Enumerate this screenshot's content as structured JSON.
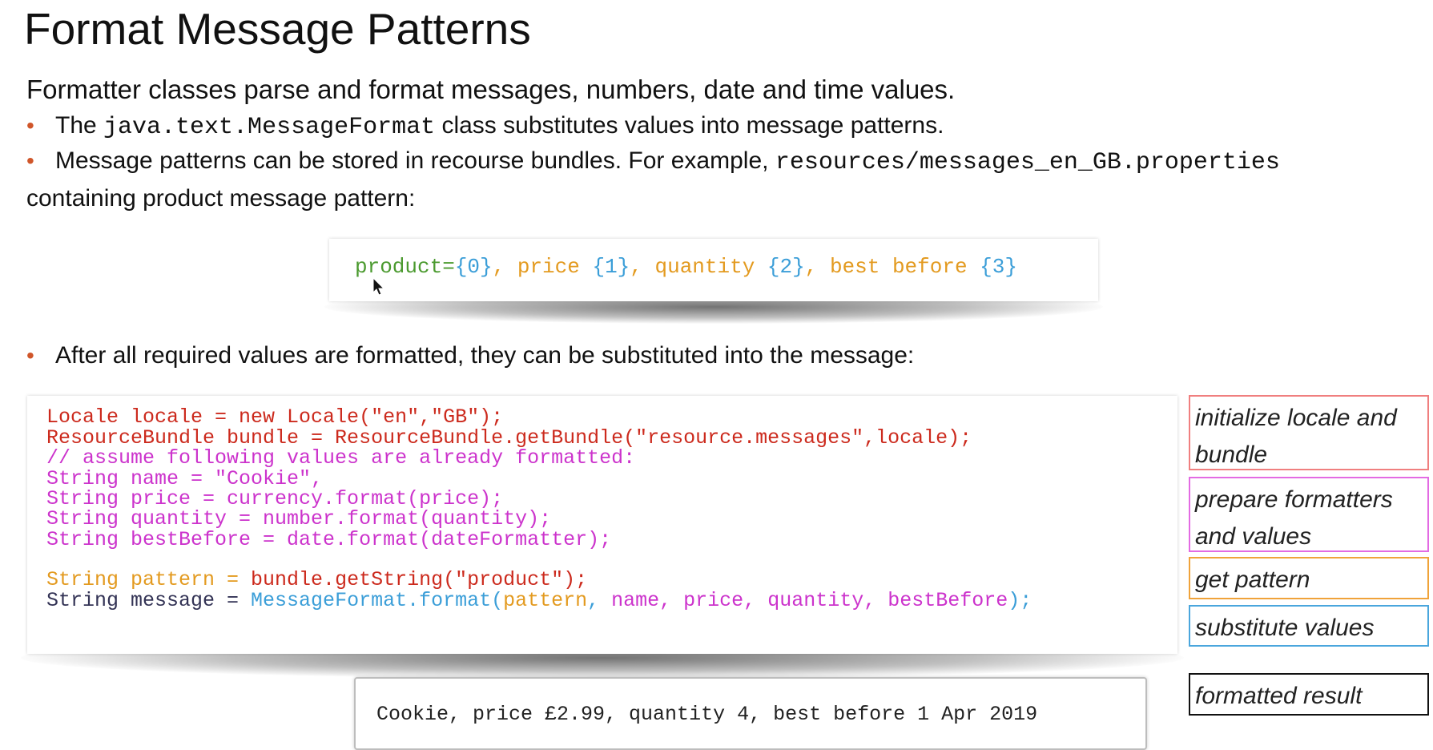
{
  "title": "Format Message Patterns",
  "intro": "Formatter classes parse and format messages, numbers, date and time values.",
  "bullets": {
    "b1_pre": "The ",
    "b1_code": "java.text.MessageFormat",
    "b1_post": " class substitutes values into message patterns.",
    "b2_pre": "Message patterns can be stored in recourse bundles. For example, ",
    "b2_code": "resources/messages_en_GB.properties",
    "b2_cont": "containing product message pattern:",
    "b3": "After all required values are formatted, they can be substituted into the message:"
  },
  "bullet_symbol": "•",
  "pattern_tokens": [
    {
      "text": "product=",
      "color": "green"
    },
    {
      "text": "{0}",
      "color": "blue"
    },
    {
      "text": ", price ",
      "color": "orange"
    },
    {
      "text": "{1}",
      "color": "blue"
    },
    {
      "text": ", quantity ",
      "color": "orange"
    },
    {
      "text": "{2}",
      "color": "blue"
    },
    {
      "text": ", best before ",
      "color": "orange"
    },
    {
      "text": "{3}",
      "color": "blue"
    }
  ],
  "code_lines": [
    [
      {
        "text": "Locale locale = new Locale(\"en\",\"GB\");",
        "color": "red"
      }
    ],
    [
      {
        "text": "ResourceBundle bundle = ResourceBundle.getBundle(\"resource.messages\",locale);",
        "color": "red"
      }
    ],
    [
      {
        "text": "// assume following values are already formatted:",
        "color": "magenta"
      }
    ],
    [
      {
        "text": "String name = \"Cookie\",",
        "color": "magenta"
      }
    ],
    [
      {
        "text": "String price = currency.format(price);",
        "color": "magenta"
      }
    ],
    [
      {
        "text": "String quantity = number.format(quantity);",
        "color": "magenta"
      }
    ],
    [
      {
        "text": "String bestBefore = date.format(dateFormatter);",
        "color": "magenta"
      }
    ],
    [],
    [
      {
        "text": "String pattern = ",
        "color": "orange"
      },
      {
        "text": "bundle.getString(\"product\");",
        "color": "red"
      }
    ],
    [
      {
        "text": "String message = ",
        "color": "navy"
      },
      {
        "text": "MessageFormat.format(",
        "color": "blue"
      },
      {
        "text": "pattern",
        "color": "orange"
      },
      {
        "text": ", ",
        "color": "blue"
      },
      {
        "text": "name, price, quantity, bestBefore",
        "color": "magenta"
      },
      {
        "text": ");",
        "color": "blue"
      }
    ]
  ],
  "result": "Cookie, price £2.99, quantity 4, best before 1 Apr 2019",
  "legend": {
    "initialize": "initialize locale and bundle",
    "prepare": "prepare formatters and values",
    "get_pattern": "get pattern",
    "substitute": "substitute values",
    "formatted_result": "formatted result"
  },
  "colors": {
    "green": "#4b9a2f",
    "blue": "#3b9ed8",
    "orange": "#e39a1f",
    "red": "#cc2a1d",
    "magenta": "#cc33cc",
    "navy": "#333355",
    "bullet": "#d0562a"
  }
}
